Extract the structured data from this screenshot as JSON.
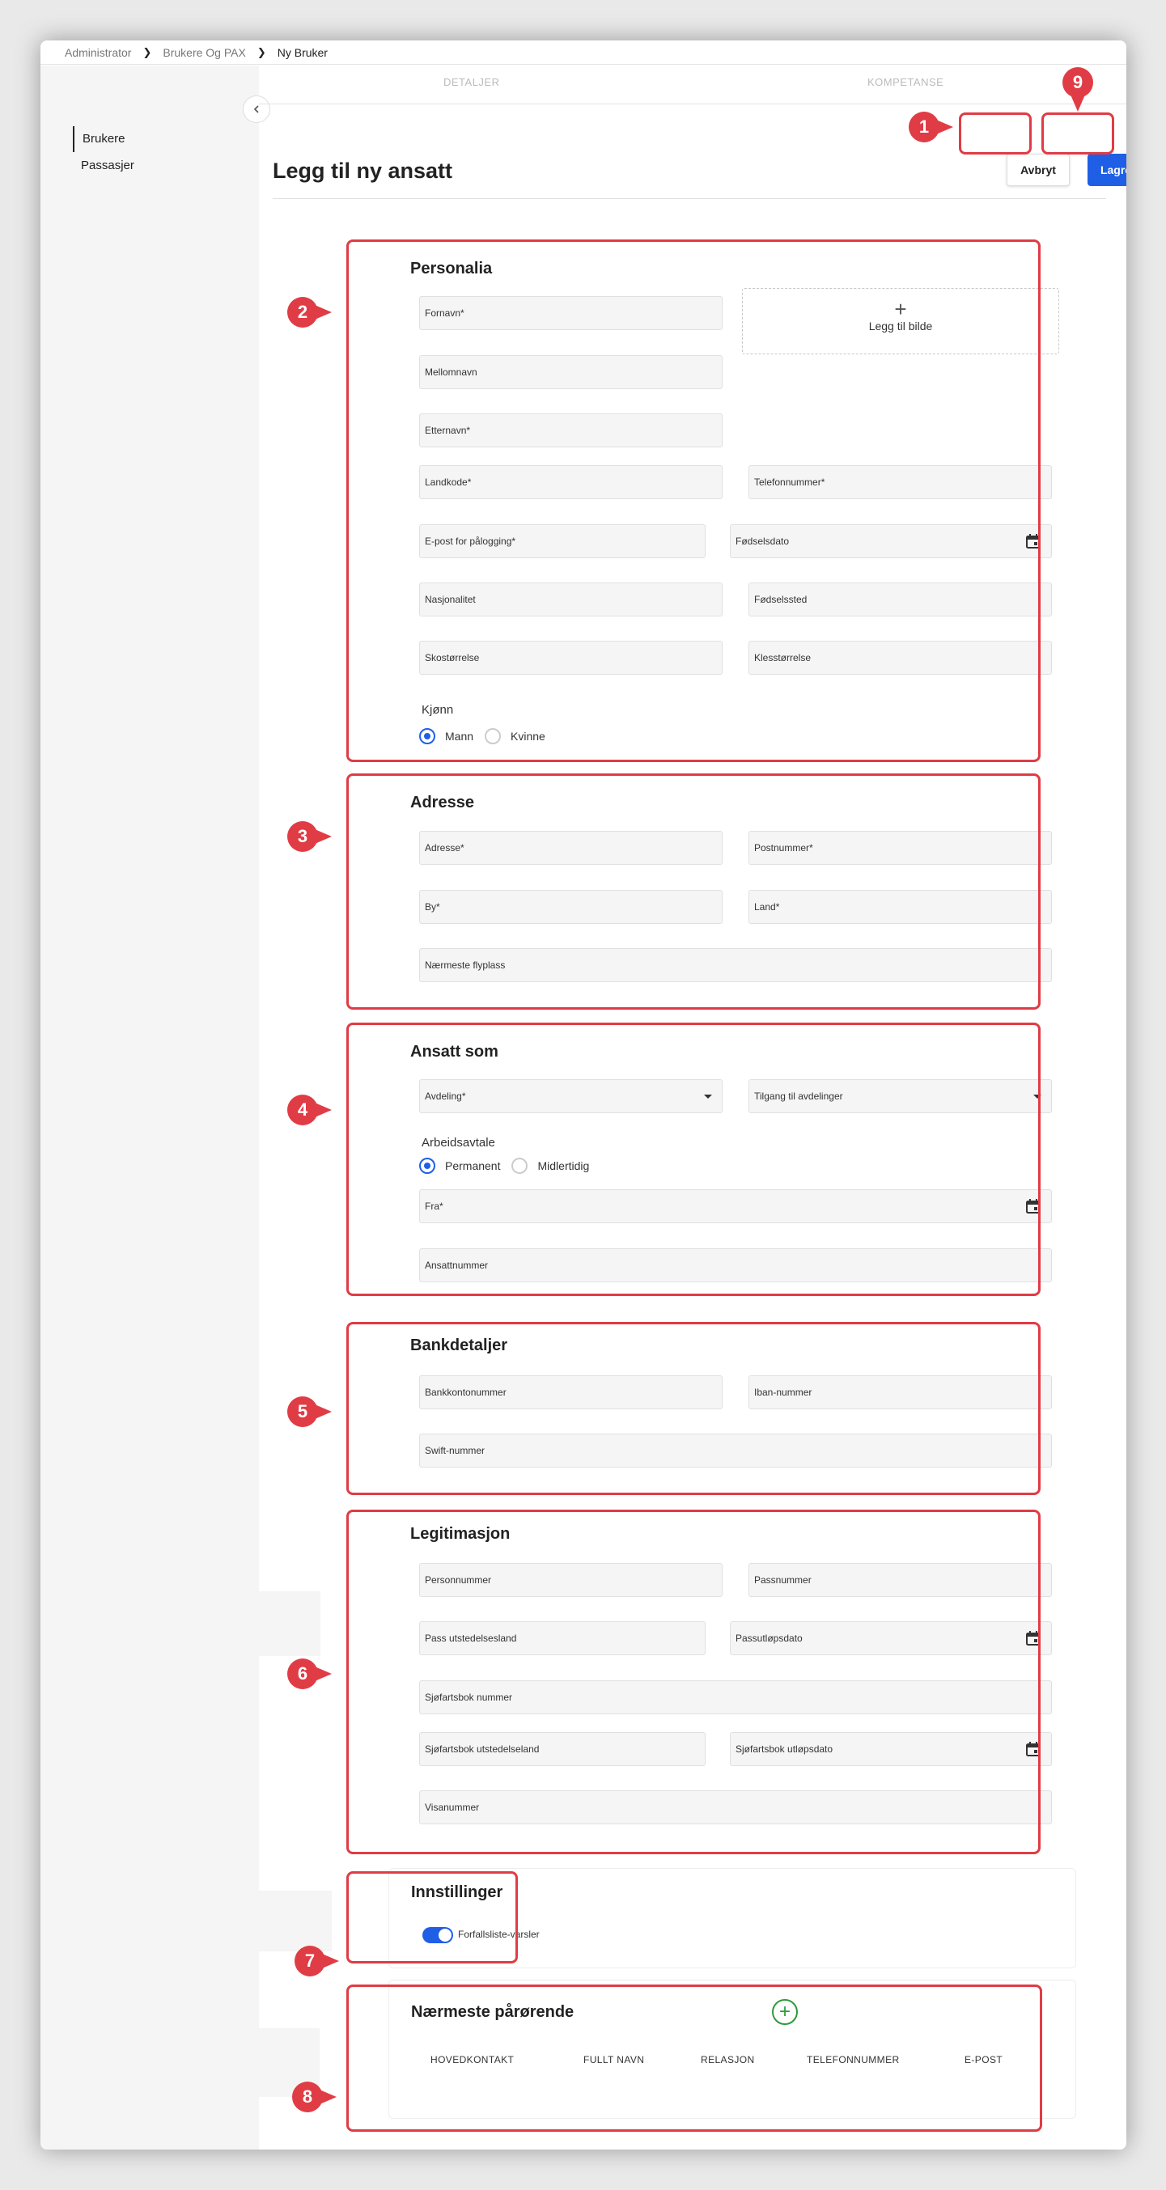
{
  "breadcrumb": [
    "Administrator",
    "Brukere Og PAX",
    "Ny Bruker"
  ],
  "sidebar": {
    "items": [
      {
        "label": "Brukere",
        "active": true
      },
      {
        "label": "Passasjer",
        "active": false
      }
    ]
  },
  "tabs": [
    {
      "label": "DETALJER"
    },
    {
      "label": "KOMPETANSE"
    }
  ],
  "page": {
    "title": "Legg til ny ansatt",
    "cancel_label": "Avbryt",
    "save_label": "Lagre"
  },
  "markers": [
    "1",
    "2",
    "3",
    "4",
    "5",
    "6",
    "7",
    "8",
    "9"
  ],
  "colors": {
    "accent": "#1f5fe6",
    "highlight": "#e03c45",
    "add": "#2e9a3a"
  },
  "personalia": {
    "title": "Personalia",
    "fornavn": "Fornavn*",
    "mellomnavn": "Mellomnavn",
    "etternavn": "Etternavn*",
    "photo_plus": "+",
    "photo_label": "Legg til bilde",
    "landkode": "Landkode*",
    "telefon": "Telefonnummer*",
    "epost": "E-post for pålogging*",
    "fodselsdato": "Fødselsdato",
    "nasjonalitet": "Nasjonalitet",
    "fodselssted": "Fødselssted",
    "sko": "Skostørrelse",
    "klaer": "Klesstørrelse",
    "kjonn_label": "Kjønn",
    "kjonn_options": [
      {
        "label": "Mann",
        "selected": true
      },
      {
        "label": "Kvinne",
        "selected": false
      }
    ]
  },
  "adresse": {
    "title": "Adresse",
    "adresse": "Adresse*",
    "postnummer": "Postnummer*",
    "by": "By*",
    "land": "Land*",
    "flyplass": "Nærmeste flyplass"
  },
  "ansatt": {
    "title": "Ansatt som",
    "avdeling": "Avdeling*",
    "tilgang": "Tilgang til avdelinger",
    "avtale_label": "Arbeidsavtale",
    "avtale_options": [
      {
        "label": "Permanent",
        "selected": true
      },
      {
        "label": "Midlertidig",
        "selected": false
      }
    ],
    "fra": "Fra*",
    "ansattnummer": "Ansattnummer"
  },
  "bank": {
    "title": "Bankdetaljer",
    "konto": "Bankkontonummer",
    "iban": "Iban-nummer",
    "swift": "Swift-nummer"
  },
  "legitimasjon": {
    "title": "Legitimasjon",
    "personnummer": "Personnummer",
    "passnummer": "Passnummer",
    "pass_land": "Pass utstedelsesland",
    "pass_utlop": "Passutløpsdato",
    "sjo_nummer": "Sjøfartsbok nummer",
    "sjo_land": "Sjøfartsbok utstedelseland",
    "sjo_utlop": "Sjøfartsbok utløpsdato",
    "visa": "Visanummer"
  },
  "innstillinger": {
    "title": "Innstillinger",
    "toggle_label": "Forfallsliste-varsler",
    "toggle_on": true
  },
  "parorende": {
    "title": "Nærmeste pårørende",
    "add_symbol": "+",
    "columns": [
      "HOVEDKONTAKT",
      "FULLT NAVN",
      "RELASJON",
      "TELEFONNUMMER",
      "E-POST"
    ]
  }
}
